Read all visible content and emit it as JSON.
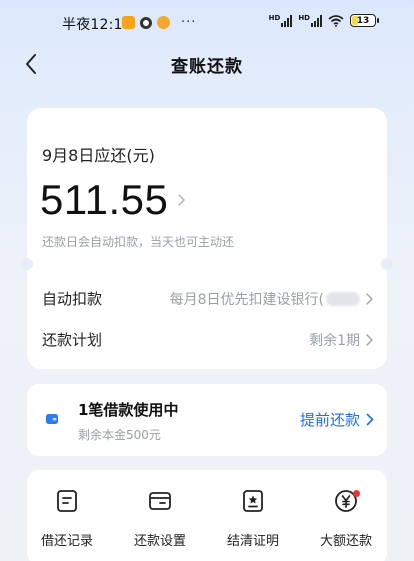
{
  "status_bar": {
    "time": "半夜12:16",
    "dots": "···",
    "battery": "13"
  },
  "header": {
    "title": "查账还款"
  },
  "bill": {
    "due_label": "9月8日应还(元)",
    "amount": "511.55",
    "note": "还款日会自动扣款，当天也可主动还"
  },
  "rows": [
    {
      "label": "自动扣款",
      "value": "每月8日优先扣建设银行("
    },
    {
      "label": "还款计划",
      "value": "剩余1期"
    }
  ],
  "loan": {
    "title": "1笔借款使用中",
    "subtitle": "剩余本金500元",
    "action": "提前还款"
  },
  "actions": [
    {
      "label": "借还记录",
      "icon": "record-icon"
    },
    {
      "label": "还款设置",
      "icon": "wallet-settings-icon"
    },
    {
      "label": "结清证明",
      "icon": "certificate-icon"
    },
    {
      "label": "大额还款",
      "icon": "yuan-icon"
    }
  ],
  "colors": {
    "accent": "#1c6ff0",
    "badge": "#f23030"
  }
}
